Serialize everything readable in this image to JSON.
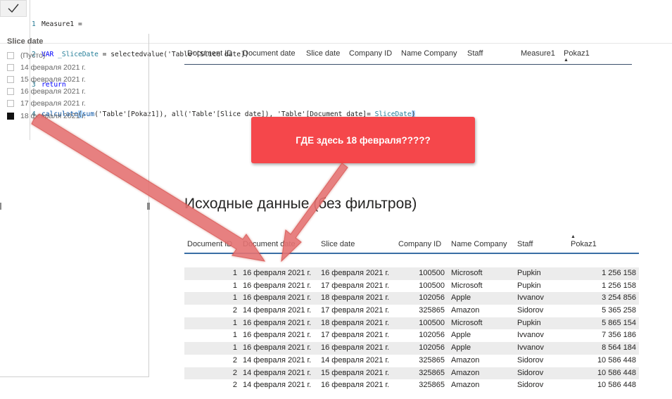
{
  "formula": {
    "lines": [
      {
        "num": "1",
        "text": "Measure1 ="
      },
      {
        "num": "2",
        "kw": "VAR",
        "var": "_SliceDate",
        "rest": " = selectedvalue('Table'[Slice date])"
      },
      {
        "num": "3",
        "kw": "return"
      },
      {
        "num": "4",
        "fn": "calculate",
        "open": "(",
        "fn2": "sum",
        "args": "('Table'[Pokaz1]), all('Table'[Slice date]), 'Table'[Document date]=",
        "var": "_SliceDate",
        "close": ")"
      }
    ]
  },
  "slicer": {
    "title": "Slice date",
    "items": [
      {
        "label": "(Пусто)",
        "checked": false
      },
      {
        "label": "14 февраля 2021 г.",
        "checked": false
      },
      {
        "label": "15 февраля 2021 г.",
        "checked": false
      },
      {
        "label": "16 февраля 2021 г.",
        "checked": false
      },
      {
        "label": "17 февраля 2021 г.",
        "checked": false
      },
      {
        "label": "18 февраля 2021 г.",
        "checked": true
      }
    ]
  },
  "top_table": {
    "headers": [
      "Document ID",
      "Document date",
      "Slice date",
      "Company ID",
      "Name Company",
      "Staff",
      "Measure1",
      "Pokaz1"
    ]
  },
  "callout": {
    "text": "ГДЕ здесь 18 февраля?????",
    "color": "#f5474b"
  },
  "section_heading": "Исходные данные (без фильтров)",
  "main_table": {
    "headers": [
      "Document ID",
      "Document date",
      "Slice date",
      "Company ID",
      "Name Company",
      "Staff",
      "Pokaz1"
    ],
    "rows": [
      [
        "1",
        "16 февраля 2021 г.",
        "16 февраля 2021 г.",
        "100500",
        "Microsoft",
        "Pupkin",
        "1 256 158"
      ],
      [
        "1",
        "16 февраля 2021 г.",
        "17 февраля 2021 г.",
        "100500",
        "Microsoft",
        "Pupkin",
        "1 256 158"
      ],
      [
        "1",
        "16 февраля 2021 г.",
        "18 февраля 2021 г.",
        "102056",
        "Apple",
        "Ivvanov",
        "3 254 856"
      ],
      [
        "2",
        "14 февраля 2021 г.",
        "17 февраля 2021 г.",
        "325865",
        "Amazon",
        "Sidorov",
        "5 365 258"
      ],
      [
        "1",
        "16 февраля 2021 г.",
        "18 февраля 2021 г.",
        "100500",
        "Microsoft",
        "Pupkin",
        "5 865 154"
      ],
      [
        "1",
        "16 февраля 2021 г.",
        "17 февраля 2021 г.",
        "102056",
        "Apple",
        "Ivvanov",
        "7 356 186"
      ],
      [
        "1",
        "16 февраля 2021 г.",
        "16 февраля 2021 г.",
        "102056",
        "Apple",
        "Ivvanov",
        "8 564 184"
      ],
      [
        "2",
        "14 февраля 2021 г.",
        "14 февраля 2021 г.",
        "325865",
        "Amazon",
        "Sidorov",
        "10 586 448"
      ],
      [
        "2",
        "14 февраля 2021 г.",
        "15 февраля 2021 г.",
        "325865",
        "Amazon",
        "Sidorov",
        "10 586 448"
      ],
      [
        "2",
        "14 февраля 2021 г.",
        "16 февраля 2021 г.",
        "325865",
        "Amazon",
        "Sidorov",
        "10 586 448"
      ]
    ]
  },
  "colors": {
    "arrow": "#e57373",
    "header_rule": "#3a6ea5",
    "row_band": "#ececec"
  }
}
